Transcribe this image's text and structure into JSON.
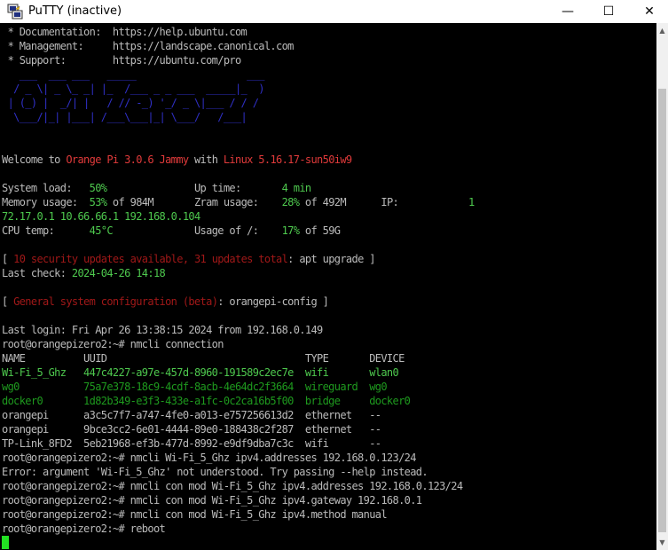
{
  "window": {
    "title": "PuTTY (inactive)",
    "minimize_glyph": "—",
    "maximize_glyph": "☐",
    "close_glyph": "✕"
  },
  "colors": {
    "background": "#000000",
    "text": "#bbbbbb",
    "green": "#4ec94e",
    "dark_green": "#1e9a1e",
    "red": "#e03a3a",
    "dark_red": "#a01818",
    "blue": "#3030c8",
    "cursor": "#22e022"
  },
  "terminal": {
    "lines": [
      [
        {
          "t": " * Documentation:  https://help.ubuntu.com",
          "c": "w"
        }
      ],
      [
        {
          "t": " * Management:     https://landscape.canonical.com",
          "c": "w"
        }
      ],
      [
        {
          "t": " * Support:        https://ubuntu.com/pro",
          "c": "w"
        }
      ],
      [
        {
          "t": "   ___  ___ ___   _____                   ___",
          "c": "b"
        }
      ],
      [
        {
          "t": "  / _ \\| _ \\_ _| |_  /___ _ _ ___  _____|_  )",
          "c": "b"
        }
      ],
      [
        {
          "t": " | (_) |  _/| |   / // -_) '_/ _ \\|___ / / /",
          "c": "b"
        }
      ],
      [
        {
          "t": "  \\___/|_| |___| /___\\___|_| \\___/   /___|",
          "c": "b"
        }
      ],
      [
        {
          "t": "                                            ",
          "c": "b"
        }
      ],
      [
        {
          "t": "",
          "c": "w"
        }
      ],
      [
        {
          "t": "Welcome to ",
          "c": "w"
        },
        {
          "t": "Orange Pi 3.0.6 Jammy",
          "c": "r"
        },
        {
          "t": " with ",
          "c": "w"
        },
        {
          "t": "Linux 5.16.17-sun50iw9",
          "c": "r"
        }
      ],
      [
        {
          "t": "",
          "c": "w"
        }
      ],
      [
        {
          "t": "System load:   ",
          "c": "w"
        },
        {
          "t": "50%",
          "c": "g"
        },
        {
          "t": "               Up time:       ",
          "c": "w"
        },
        {
          "t": "4 min",
          "c": "g"
        }
      ],
      [
        {
          "t": "Memory usage:  ",
          "c": "w"
        },
        {
          "t": "53%",
          "c": "g"
        },
        {
          "t": " of 984M       Zram usage:    ",
          "c": "w"
        },
        {
          "t": "28%",
          "c": "g"
        },
        {
          "t": " of 492M      IP:            ",
          "c": "w"
        },
        {
          "t": "1",
          "c": "g"
        }
      ],
      [
        {
          "t": "72.17.0.1 10.66.66.1 192.168.0.104",
          "c": "g"
        }
      ],
      [
        {
          "t": "CPU temp:      ",
          "c": "w"
        },
        {
          "t": "45°C",
          "c": "g"
        },
        {
          "t": "              Usage of /:    ",
          "c": "w"
        },
        {
          "t": "17%",
          "c": "g"
        },
        {
          "t": " of 59G",
          "c": "w"
        }
      ],
      [
        {
          "t": "",
          "c": "w"
        }
      ],
      [
        {
          "t": "[ ",
          "c": "w"
        },
        {
          "t": "10 security updates available, 31 updates total",
          "c": "dr"
        },
        {
          "t": ": apt upgrade ]",
          "c": "w"
        }
      ],
      [
        {
          "t": "Last check: ",
          "c": "w"
        },
        {
          "t": "2024-04-26 14:18",
          "c": "g"
        }
      ],
      [
        {
          "t": "",
          "c": "w"
        }
      ],
      [
        {
          "t": "[ ",
          "c": "w"
        },
        {
          "t": "General system configuration (beta)",
          "c": "dr"
        },
        {
          "t": ": orangepi-config ]",
          "c": "w"
        }
      ],
      [
        {
          "t": "",
          "c": "w"
        }
      ],
      [
        {
          "t": "Last login: Fri Apr 26 13:38:15 2024 from 192.168.0.149",
          "c": "w"
        }
      ],
      [
        {
          "t": "root@orangepizero2:~# nmcli connection",
          "c": "w"
        }
      ],
      [
        {
          "t": "NAME          UUID                                  TYPE       DEVICE",
          "c": "w"
        }
      ],
      [
        {
          "t": "Wi-Fi_5_Ghz   447c4227-a97e-457d-8960-191589c2ec7e  wifi       wlan0",
          "c": "g"
        }
      ],
      [
        {
          "t": "wg0           75a7e378-18c9-4cdf-8acb-4e64dc2f3664  wireguard  wg0",
          "c": "dg"
        }
      ],
      [
        {
          "t": "docker0       1d82b349-e3f3-433e-a1fc-0c2ca16b5f00  bridge     docker0",
          "c": "dg"
        }
      ],
      [
        {
          "t": "orangepi      a3c5c7f7-a747-4fe0-a013-e757256613d2  ethernet   --",
          "c": "w"
        }
      ],
      [
        {
          "t": "orangepi      9bce3cc2-6e01-4444-89e0-188438c2f287  ethernet   --",
          "c": "w"
        }
      ],
      [
        {
          "t": "TP-Link_8FD2  5eb21968-ef3b-477d-8992-e9df9dba7c3c  wifi       --",
          "c": "w"
        }
      ],
      [
        {
          "t": "root@orangepizero2:~# nmcli Wi-Fi_5_Ghz ipv4.addresses 192.168.0.123/24",
          "c": "w"
        }
      ],
      [
        {
          "t": "Error: argument 'Wi-Fi_5_Ghz' not understood. Try passing --help instead.",
          "c": "w"
        }
      ],
      [
        {
          "t": "root@orangepizero2:~# nmcli con mod Wi-Fi_5_Ghz ipv4.addresses 192.168.0.123/24",
          "c": "w"
        }
      ],
      [
        {
          "t": "root@orangepizero2:~# nmcli con mod Wi-Fi_5_Ghz ipv4.gateway 192.168.0.1",
          "c": "w"
        }
      ],
      [
        {
          "t": "root@orangepizero2:~# nmcli con mod Wi-Fi_5_Ghz ipv4.method manual",
          "c": "w"
        }
      ],
      [
        {
          "t": "root@orangepizero2:~# reboot",
          "c": "w"
        }
      ]
    ]
  },
  "icons": {
    "app": "putty-icon",
    "scroll_up": "scroll-up-arrow-icon",
    "scroll_down": "scroll-down-arrow-icon"
  }
}
